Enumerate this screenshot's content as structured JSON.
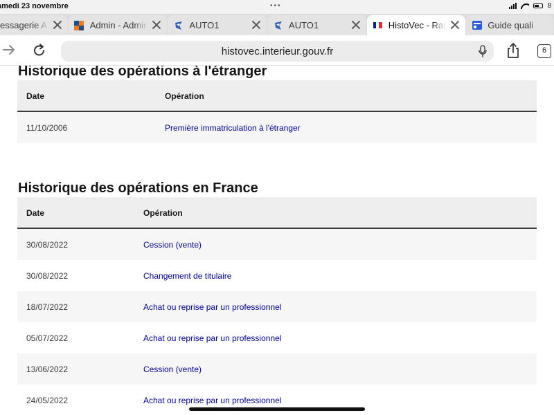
{
  "status_bar": {
    "time": "amedi 23 novembre",
    "dots": "•••",
    "battery": "8"
  },
  "tabs": [
    {
      "title": "essagerie AUT",
      "favicon": "mail-favicon"
    },
    {
      "title": "Admin - Admin C",
      "favicon": "admin-favicon"
    },
    {
      "title": "AUTO1",
      "favicon": "auto1-favicon"
    },
    {
      "title": "AUTO1",
      "favicon": "auto1-favicon"
    },
    {
      "title": "HistoVec - Rappo",
      "favicon": "french-flag-favicon",
      "active": true
    },
    {
      "title": "Guide qualité - C",
      "favicon": "guide-favicon"
    }
  ],
  "toolbar": {
    "url": "histovec.interieur.gouv.fr",
    "tab_count": "6"
  },
  "abroad": {
    "title": "Historique des opérations à l'étranger",
    "col_date": "Date",
    "col_operation": "Opération",
    "rows": [
      {
        "date": "11/10/2006",
        "operation": "Première immatriculation à l'étranger"
      }
    ]
  },
  "france": {
    "title": "Historique des opérations en France",
    "col_date": "Date",
    "col_operation": "Opération",
    "rows": [
      {
        "date": "30/08/2022",
        "operation": "Cession (vente)"
      },
      {
        "date": "30/08/2022",
        "operation": "Changement de titulaire"
      },
      {
        "date": "18/07/2022",
        "operation": "Achat ou reprise par un professionnel"
      },
      {
        "date": "05/07/2022",
        "operation": "Achat ou reprise par un professionnel"
      },
      {
        "date": "13/06/2022",
        "operation": "Cession (vente)"
      },
      {
        "date": "24/05/2022",
        "operation": "Achat ou reprise par un professionnel"
      }
    ]
  },
  "colors": {
    "link": "#000091",
    "flag_blue": "#002395",
    "flag_white": "#ffffff",
    "flag_red": "#ed2939",
    "admin_orange": "#f07c1b",
    "admin_blue": "#1b4e8e",
    "auto1_blue": "#2c5fb3"
  }
}
